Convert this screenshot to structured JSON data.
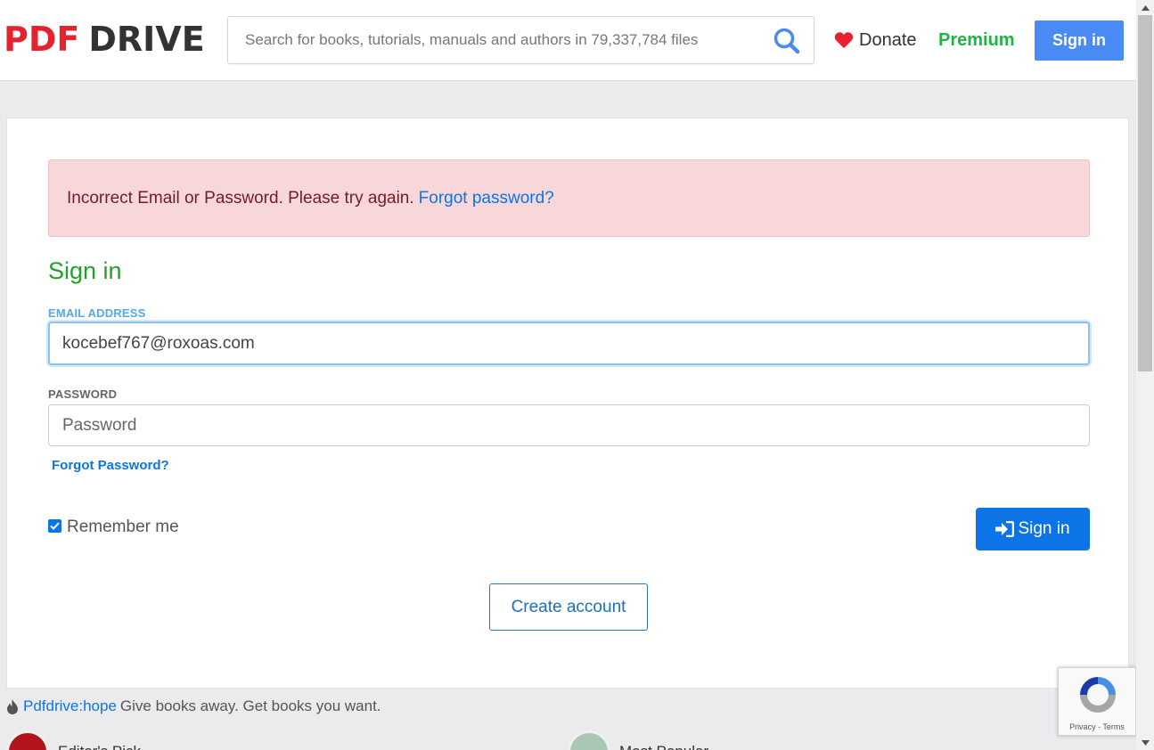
{
  "header": {
    "logo_pdf": "PDF",
    "logo_drive": "DRIVE",
    "search_placeholder": "Search for books, tutorials, manuals and authors in 79,337,784 files",
    "donate_label": "Donate",
    "premium_label": "Premium",
    "signin_label": "Sign in"
  },
  "alert": {
    "message": "Incorrect Email or Password. Please try again.",
    "link": "Forgot password?"
  },
  "form": {
    "title": "Sign in",
    "email_label": "EMAIL ADDRESS",
    "email_value": "kocebef767@roxoas.com",
    "password_label": "PASSWORD",
    "password_placeholder": "Password",
    "forgot_label": "Forgot Password?",
    "remember_label": "Remember me",
    "remember_checked": true,
    "signin_label": "Sign in",
    "create_label": "Create account"
  },
  "footer": {
    "hope_link": "Pdfdrive:hope",
    "hope_text": "Give books away. Get books you want.",
    "item1": "Editor's Pick",
    "item2": "Most Popular"
  },
  "recaptcha": {
    "privacy": "Privacy",
    "terms": "Terms"
  },
  "colors": {
    "logo_red": "#e5232f",
    "premium_green": "#20b345",
    "title_green": "#21a127",
    "primary_blue": "#0d74e7",
    "alert_bg": "#f8d7da"
  }
}
